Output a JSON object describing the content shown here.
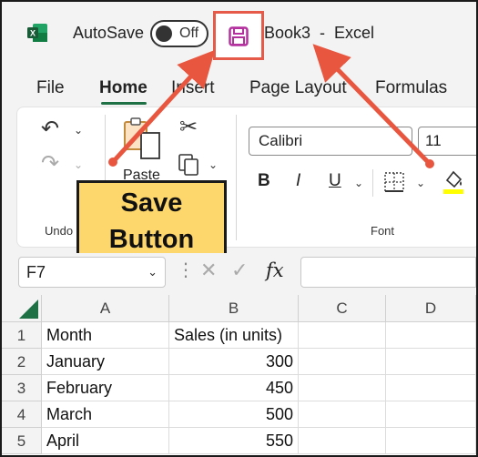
{
  "titlebar": {
    "autosave_label": "AutoSave",
    "autosave_state": "Off",
    "doc_title": "Book3  -  Excel",
    "excel_brand_color": "#1e7145",
    "save_icon_color": "#b4309e"
  },
  "tabs": [
    {
      "label": "File",
      "active": false
    },
    {
      "label": "Home",
      "active": true
    },
    {
      "label": "Insert",
      "active": false
    },
    {
      "label": "Page Layout",
      "active": false
    },
    {
      "label": "Formulas",
      "active": false
    }
  ],
  "ribbon": {
    "undo_group_label": "Undo",
    "paste_label": "Paste",
    "font_group_label": "Font",
    "font_name": "Calibri",
    "font_size": "11",
    "bold_label": "B",
    "italic_label": "I",
    "underline_label": "U"
  },
  "callout": {
    "line1": "Save",
    "line2": "Button",
    "bg_color": "#fdd76c",
    "arrow_color": "#e8563f"
  },
  "formula_bar": {
    "name_box": "F7",
    "fx_label": "fx"
  },
  "grid": {
    "columns": [
      "A",
      "B",
      "C",
      "D"
    ],
    "rows": [
      {
        "num": "1",
        "a": "Month",
        "b": "Sales (in units)"
      },
      {
        "num": "2",
        "a": "January",
        "b": "300"
      },
      {
        "num": "3",
        "a": "February",
        "b": "450"
      },
      {
        "num": "4",
        "a": "March",
        "b": "500"
      },
      {
        "num": "5",
        "a": "April",
        "b": "550"
      }
    ]
  }
}
